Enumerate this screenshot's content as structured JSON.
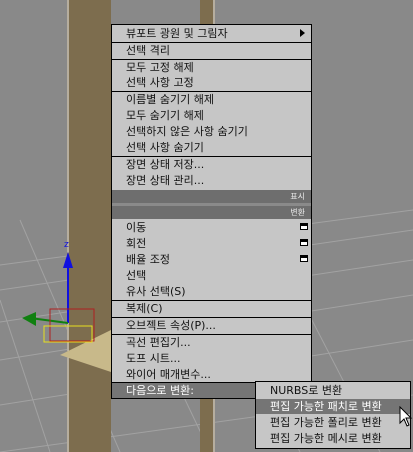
{
  "menu": {
    "items": [
      {
        "label": "뷰포트 광원 및 그림자",
        "arrow": true
      },
      {
        "label": "선택 격리"
      },
      {
        "label": "모두 고정 해제"
      },
      {
        "label": "선택 사항 고정"
      },
      {
        "label": "이름별 숨기기 해제"
      },
      {
        "label": "모두 숨기기 해제"
      },
      {
        "label": "선택하지 않은 사항 숨기기"
      },
      {
        "label": "선택 사항 숨기기"
      },
      {
        "label": "장면 상태 저장..."
      },
      {
        "label": "장면 상태 관리..."
      },
      {
        "label": "이동",
        "box": true
      },
      {
        "label": "회전",
        "box": true
      },
      {
        "label": "배율 조정",
        "box": true
      },
      {
        "label": "선택"
      },
      {
        "label": "유사 선택(S)"
      },
      {
        "label": "복제(C)"
      },
      {
        "label": "오브젝트 속성(P)..."
      },
      {
        "label": "곡선 편집기..."
      },
      {
        "label": "도프 시트..."
      },
      {
        "label": "와이어 매개변수..."
      },
      {
        "label": "다음으로 변환:",
        "arrow": true
      }
    ],
    "headers": {
      "display": "표시",
      "transform": "변환"
    }
  },
  "submenu": {
    "items": [
      {
        "label": "NURBS로 변환"
      },
      {
        "label": "편집 가능한 패치로 변환"
      },
      {
        "label": "편집 가능한 폴리로 변환"
      },
      {
        "label": "편집 가능한 메시로 변환"
      }
    ]
  },
  "gizmo": {
    "z_label": "z"
  },
  "colors": {
    "menu_bg": "#c6c6c6",
    "highlight": "#757575",
    "header": "#6e6e6e",
    "viewport": "#898989",
    "panel": "#7d6d4e"
  }
}
